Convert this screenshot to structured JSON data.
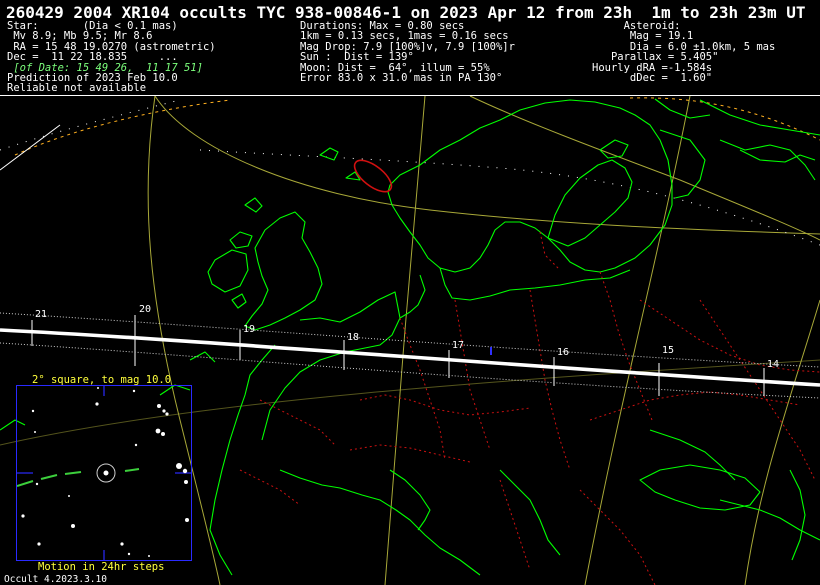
{
  "header": {
    "title": "260429 2004 XR104 occults TYC 938-00846-1 on 2023 Apr 12 from 23h  1m to 23h 23m UT",
    "left": {
      "star_label": "Star:       (Dia < 0.1 mas)",
      "mags": " Mv 8.9; Mb 9.5; Mr 8.6",
      "ra": " RA = 15 48 19.0270 (astrometric)",
      "dec": "Dec =  11 22 18.835     ...",
      "of_date": " [of Date: 15 49 26,  11 17 51]",
      "prediction": "Prediction of 2023 Feb 10.0",
      "reliable": "Reliable not available"
    },
    "mid": {
      "durations": "Durations: Max = 0.80 secs",
      "km": "1km = 0.13 secs, 1mas = 0.16 secs",
      "mag_drop": "Mag Drop: 7.9 [100%]v, 7.9 [100%]r",
      "sun": "Sun :  Dist = 139°",
      "moon": "Moon: Dist =  64°, illum = 55%",
      "error": "Error 83.0 x 31.0 mas in PA 130°"
    },
    "right": {
      "asteroid": "     Asteroid:",
      "mag": "      Mag = 19.1",
      "dia": "      Dia = 6.0 ±1.0km, 5 mas",
      "parallax": "   Parallax = 5.405\"",
      "hourly_dra": "Hourly dRA =-1.584s",
      "ddec": "      dDec =  1.60\""
    }
  },
  "path": {
    "times": [
      "21",
      "20",
      "19",
      "18",
      "17",
      "16",
      "15",
      "14"
    ]
  },
  "inset": {
    "title": "2° square, to mag 10.0",
    "footer": "Motion in 24hr steps"
  },
  "software": "Occult 4.2023.3.10",
  "colors": {
    "coast": "#00ff00",
    "border": "#cc1111",
    "graticule": "#a8a838",
    "path": "#ffffff",
    "limits": "#cfcfcf",
    "ellipse": "#d01010",
    "inset_border": "#2a2aff",
    "inset_text": "#ffff3c"
  }
}
